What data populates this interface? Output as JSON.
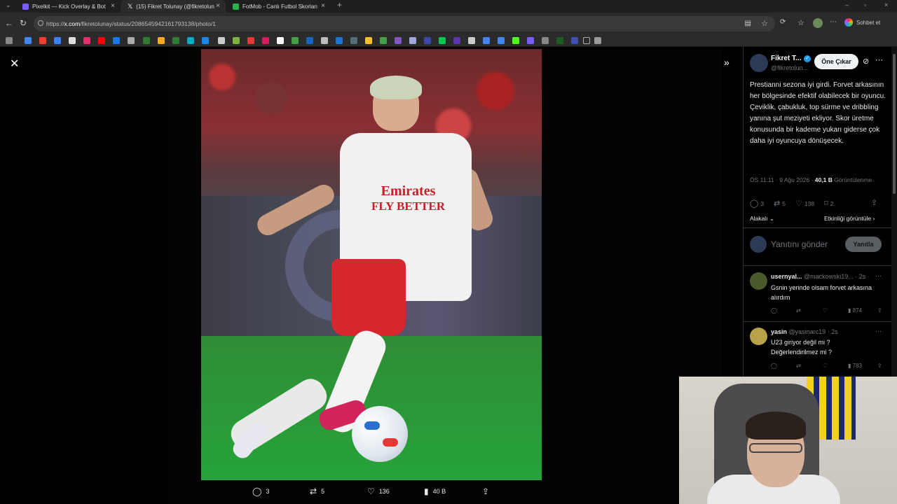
{
  "browser": {
    "tabs": [
      {
        "title": "Pixelkit — Kick Overlay & Bot",
        "color": "#7b5cff"
      },
      {
        "title": "(15) Fikret Tolunay (@fikretolunay)",
        "color": "#ffffff"
      },
      {
        "title": "FotMob - Canlı Futbol Skorları",
        "color": "#27b24a"
      }
    ],
    "url_prefix": "https://",
    "url_host": "x.com",
    "url_path": "/fikretolunay/status/2086545942161793138/photo/1",
    "chat_label": "Sohbet et"
  },
  "photo_actions": {
    "replies": "3",
    "reposts": "5",
    "likes": "136",
    "views": "40 B"
  },
  "photo_text": {
    "sponsor_line1": "Emirates",
    "sponsor_line2": "FLY BETTER"
  },
  "tweet": {
    "author_name": "Fikret T...",
    "author_handle": "@fikretolun...",
    "follow_label": "Öne Çıkar",
    "text": "Prestianni sezona iyi girdi. Forvet arkasının her bölgesinde efektif olabilecek bir oyuncu. Çeviklik, çabukluk, top sürme ve dribbling yanına şut meziyeti ekliyor. Skor üretme konusunda bir kademe yukarı giderse çok daha iyi oyuncuya dönüşecek.",
    "time": "ÖS 11:11 · 9 Ağu 2026 ·",
    "views": "40,1 B",
    "views_label": "Görüntülenme",
    "replies": "3",
    "reposts": "5",
    "likes": "138",
    "bookmarks": "2",
    "sort_label": "Alakalı",
    "activity_label": "Etkinliği görüntüle"
  },
  "reply_box": {
    "placeholder": "Yanıtını gönder",
    "button": "Yanıtla"
  },
  "comments": [
    {
      "name": "usernyal...",
      "handle": "@mackowski19... · 2s",
      "text": "Gsnin yerinde olsam forvet arkasına alırdım",
      "views": "874",
      "avatar_color": "#4a5a2a"
    },
    {
      "name": "yasin",
      "handle": "@yasinarc19 · 2s",
      "text": "U23 giriyor değil mi ? Değerlendirilmez mi ?",
      "views": "783",
      "avatar_color": "#b8a34a"
    }
  ]
}
